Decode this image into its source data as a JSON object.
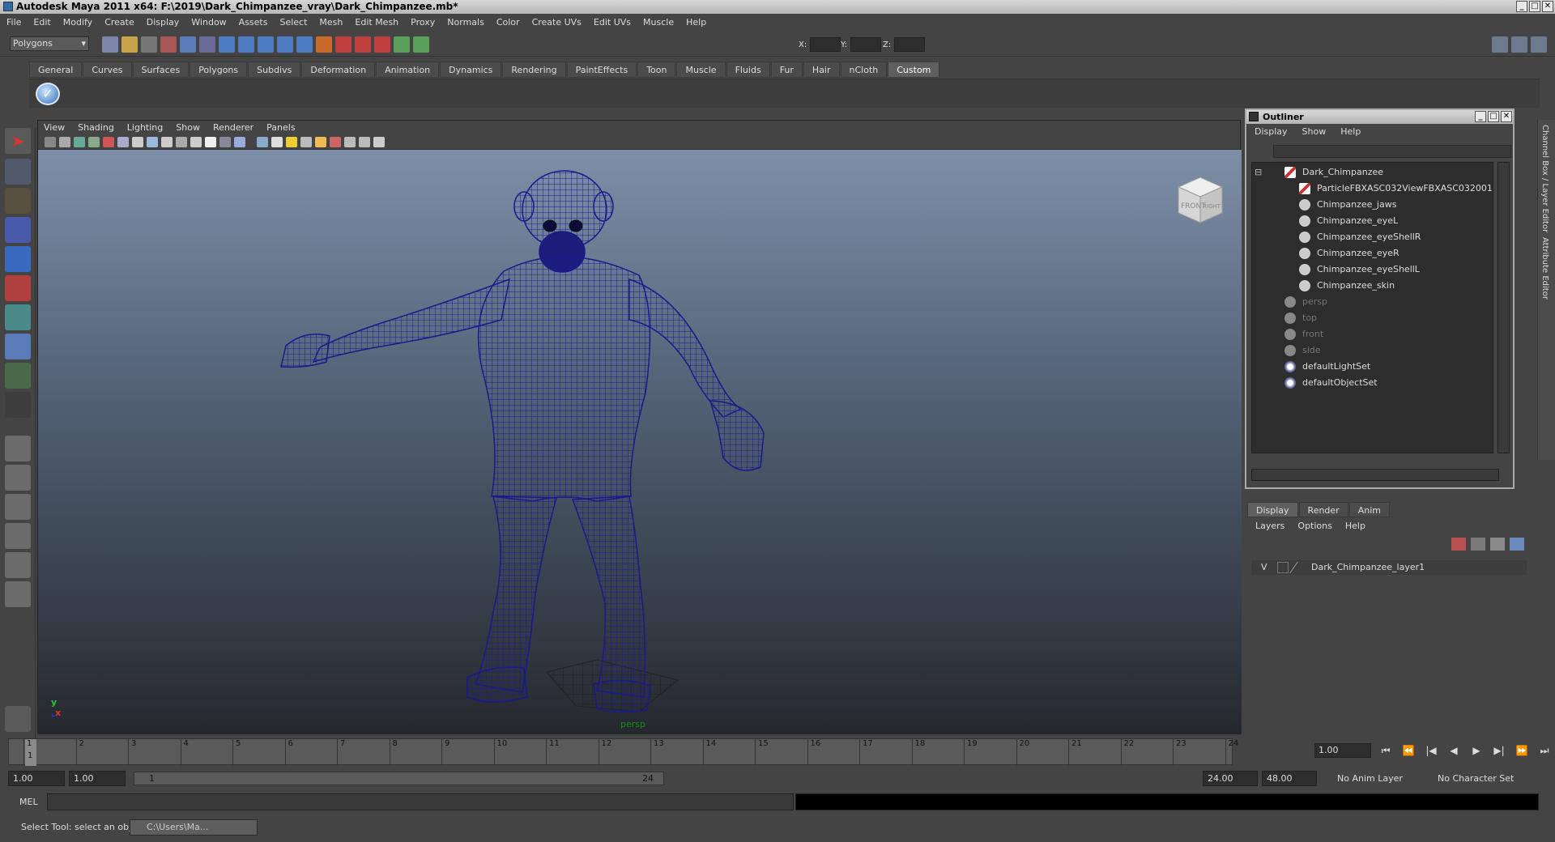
{
  "window": {
    "title": "Autodesk Maya 2011 x64: F:\\2019\\Dark_Chimpanzee_vray\\Dark_Chimpanzee.mb*"
  },
  "menu": [
    "File",
    "Edit",
    "Modify",
    "Create",
    "Display",
    "Window",
    "Assets",
    "Select",
    "Mesh",
    "Edit Mesh",
    "Proxy",
    "Normals",
    "Color",
    "Create UVs",
    "Edit UVs",
    "Muscle",
    "Help"
  ],
  "statusline": {
    "mode": "Polygons",
    "x_label": "X:",
    "y_label": "Y:",
    "z_label": "Z:"
  },
  "shelf_tabs": [
    "General",
    "Curves",
    "Surfaces",
    "Polygons",
    "Subdivs",
    "Deformation",
    "Animation",
    "Dynamics",
    "Rendering",
    "PaintEffects",
    "Toon",
    "Muscle",
    "Fluids",
    "Fur",
    "Hair",
    "nCloth",
    "Custom"
  ],
  "shelf_active": "Custom",
  "viewport": {
    "menus": [
      "View",
      "Shading",
      "Lighting",
      "Show",
      "Renderer",
      "Panels"
    ],
    "camera": "persp",
    "axis_y": "y",
    "axis_x": "x",
    "cube_front": "FRONT",
    "cube_right": "RIGHT",
    "mesh_color": "#1c1c9a"
  },
  "outliner": {
    "title": "Outliner",
    "menus": [
      "Display",
      "Show",
      "Help"
    ],
    "items": [
      {
        "label": "Dark_Chimpanzee",
        "kind": "transform"
      },
      {
        "label": "ParticleFBXASC032ViewFBXASC032001",
        "kind": "transform"
      },
      {
        "label": "Chimpanzee_jaws",
        "kind": "mesh"
      },
      {
        "label": "Chimpanzee_eyeL",
        "kind": "mesh"
      },
      {
        "label": "Chimpanzee_eyeShellR",
        "kind": "mesh"
      },
      {
        "label": "Chimpanzee_eyeR",
        "kind": "mesh"
      },
      {
        "label": "Chimpanzee_eyeShellL",
        "kind": "mesh"
      },
      {
        "label": "Chimpanzee_skin",
        "kind": "mesh"
      },
      {
        "label": "persp",
        "kind": "camera"
      },
      {
        "label": "top",
        "kind": "camera"
      },
      {
        "label": "front",
        "kind": "camera"
      },
      {
        "label": "side",
        "kind": "camera"
      },
      {
        "label": "defaultLightSet",
        "kind": "set"
      },
      {
        "label": "defaultObjectSet",
        "kind": "set"
      }
    ]
  },
  "side_tabs": [
    "Channel Box / Layer Editor",
    "Attribute Editor"
  ],
  "layers": {
    "tabs": [
      "Display",
      "Render",
      "Anim"
    ],
    "menus": [
      "Layers",
      "Options",
      "Help"
    ],
    "layer": {
      "visible": "V",
      "name": "Dark_Chimpanzee_layer1"
    }
  },
  "timeline": {
    "frames": [
      "1",
      "2",
      "3",
      "4",
      "5",
      "6",
      "7",
      "8",
      "9",
      "10",
      "11",
      "12",
      "13",
      "14",
      "15",
      "16",
      "17",
      "18",
      "19",
      "20",
      "21",
      "22",
      "23",
      "24"
    ],
    "current_marker": "1",
    "current_time": "1.00"
  },
  "range": {
    "start": "1.00",
    "playback_start": "1.00",
    "slider_start": "1",
    "slider_end": "24",
    "playback_end": "24.00",
    "end": "48.00",
    "anim_layer": "No Anim Layer",
    "char_set": "No Character Set"
  },
  "command": {
    "label": "MEL"
  },
  "help": {
    "text": "Select Tool: select an object",
    "task": "C:\\Users\\Ma..."
  }
}
